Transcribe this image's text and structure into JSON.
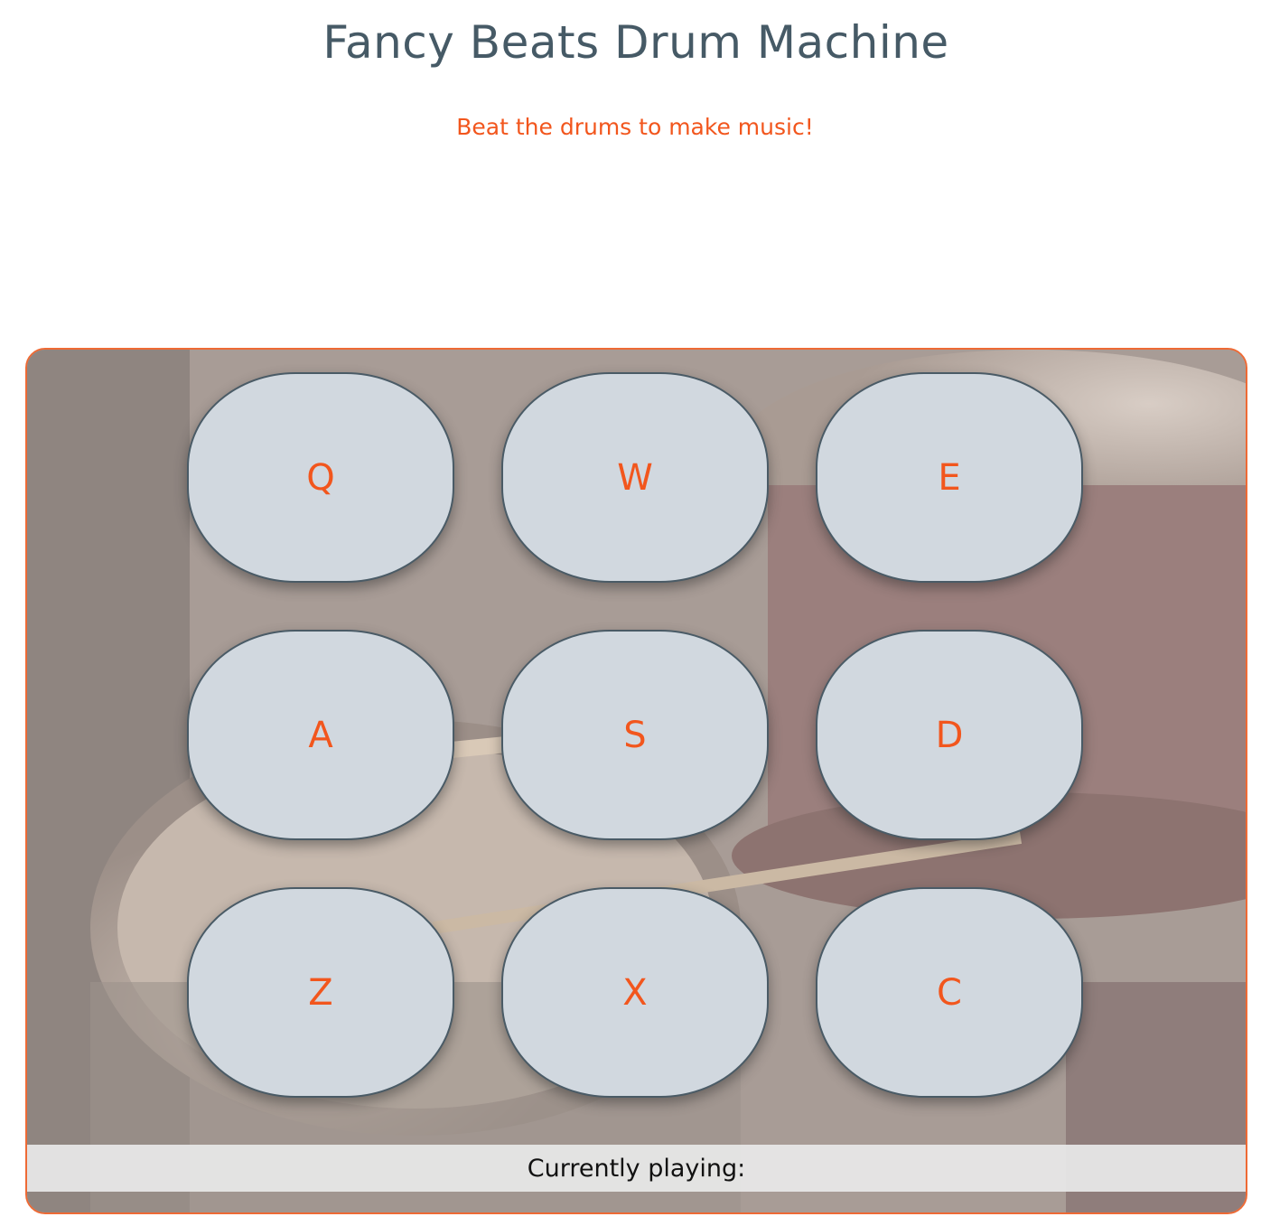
{
  "header": {
    "title": "Fancy Beats Drum Machine",
    "subtitle": "Beat the drums to make music!"
  },
  "drum_pads": [
    {
      "key": "Q"
    },
    {
      "key": "W"
    },
    {
      "key": "E"
    },
    {
      "key": "A"
    },
    {
      "key": "S"
    },
    {
      "key": "D"
    },
    {
      "key": "Z"
    },
    {
      "key": "X"
    },
    {
      "key": "C"
    }
  ],
  "status": {
    "label": "Currently playing:"
  },
  "colors": {
    "accent": "#f2561d",
    "title": "#465a66",
    "pad_fill": "#d1d8df",
    "pad_border": "#4a5b66",
    "frame_border": "#ee6a35"
  }
}
